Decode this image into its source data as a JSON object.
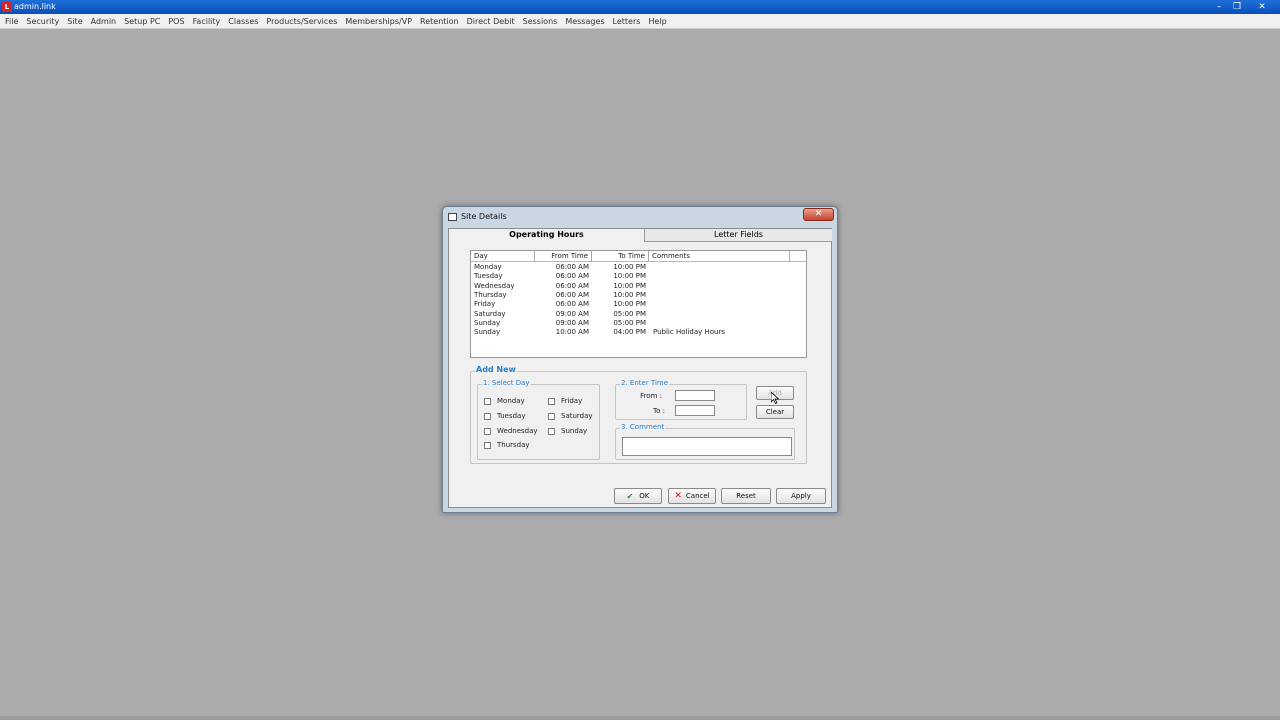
{
  "app": {
    "title": "admin.link",
    "icon_label": "L"
  },
  "window_controls": {
    "minimize": "–",
    "maximize": "❐",
    "close": "✕"
  },
  "menu": [
    "File",
    "Security",
    "Site",
    "Admin",
    "Setup PC",
    "POS",
    "Facility",
    "Classes",
    "Products/Services",
    "Memberships/VP",
    "Retention",
    "Direct Debit",
    "Sessions",
    "Messages",
    "Letters",
    "Help"
  ],
  "dialog": {
    "title": "Site Details",
    "close": "✕",
    "tabs": {
      "active": "Operating Hours",
      "inactive": "Letter Fields"
    },
    "table": {
      "headers": {
        "day": "Day",
        "from": "From Time",
        "to": "To Time",
        "comments": "Comments"
      },
      "rows": [
        {
          "day": "Monday",
          "from": "06:00 AM",
          "to": "10:00 PM",
          "comment": ""
        },
        {
          "day": "Tuesday",
          "from": "06:00 AM",
          "to": "10:00 PM",
          "comment": ""
        },
        {
          "day": "Wednesday",
          "from": "06:00 AM",
          "to": "10:00 PM",
          "comment": ""
        },
        {
          "day": "Thursday",
          "from": "06:00 AM",
          "to": "10:00 PM",
          "comment": ""
        },
        {
          "day": "Friday",
          "from": "06:00 AM",
          "to": "10:00 PM",
          "comment": ""
        },
        {
          "day": "Saturday",
          "from": "09:00 AM",
          "to": "05:00 PM",
          "comment": ""
        },
        {
          "day": "Sunday",
          "from": "09:00 AM",
          "to": "05:00 PM",
          "comment": ""
        },
        {
          "day": "Sunday",
          "from": "10:00 AM",
          "to": "04:00 PM",
          "comment": "Public Holiday Hours"
        }
      ]
    },
    "add_new": {
      "label": "Add New",
      "select_day": {
        "label": "1. Select Day",
        "days_col1": [
          "Monday",
          "Tuesday",
          "Wednesday",
          "Thursday"
        ],
        "days_col2": [
          "Friday",
          "Saturday",
          "Sunday"
        ]
      },
      "enter_time": {
        "label": "2. Enter Time",
        "from_label": "From :",
        "to_label": "To :",
        "from_value": "",
        "to_value": ""
      },
      "comment": {
        "label": "3. Comment",
        "value": ""
      },
      "add_button": "Add",
      "clear_button": "Clear"
    },
    "buttons": {
      "ok": "OK",
      "cancel": "Cancel",
      "reset": "Reset",
      "apply": "Apply"
    }
  }
}
